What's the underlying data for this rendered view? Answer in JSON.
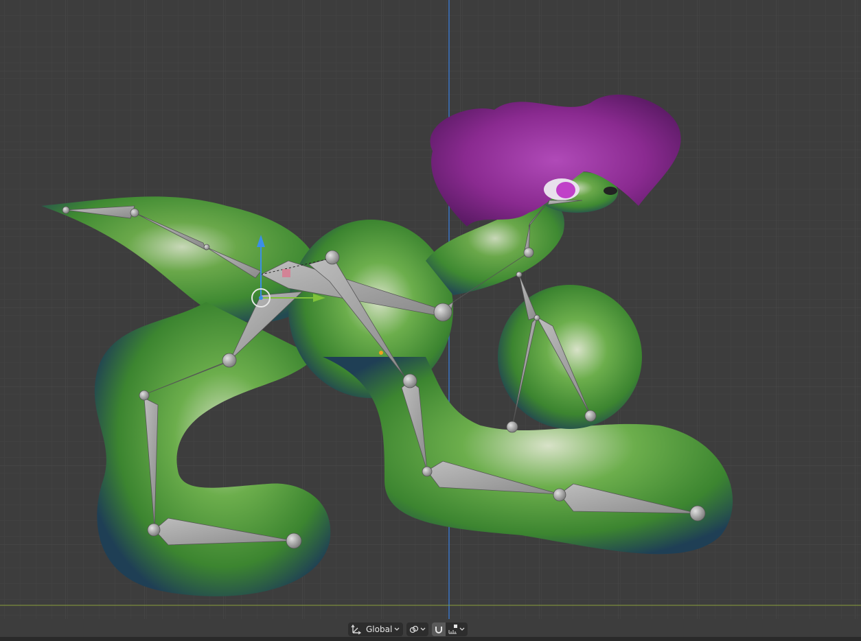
{
  "header": {
    "transform_orientation": {
      "label": "Global",
      "icon": "transform-orientation-icon"
    },
    "pivot_point": {
      "icon": "link-icon"
    },
    "snap": {
      "toggle_icon": "magnet-icon",
      "dropdown_icon": "snap-increment-icon"
    }
  },
  "viewport": {
    "background_color": "#3d3d3d",
    "grid_color": "#474747",
    "grid_major_color": "#4d4d4d",
    "y_axis_color": "#3a74c4",
    "x_axis_color": "#8aa13c",
    "mesh_color": "#4f9a3a",
    "hair_color": "#8a2a90",
    "bone_color": "#9a9a9a"
  }
}
